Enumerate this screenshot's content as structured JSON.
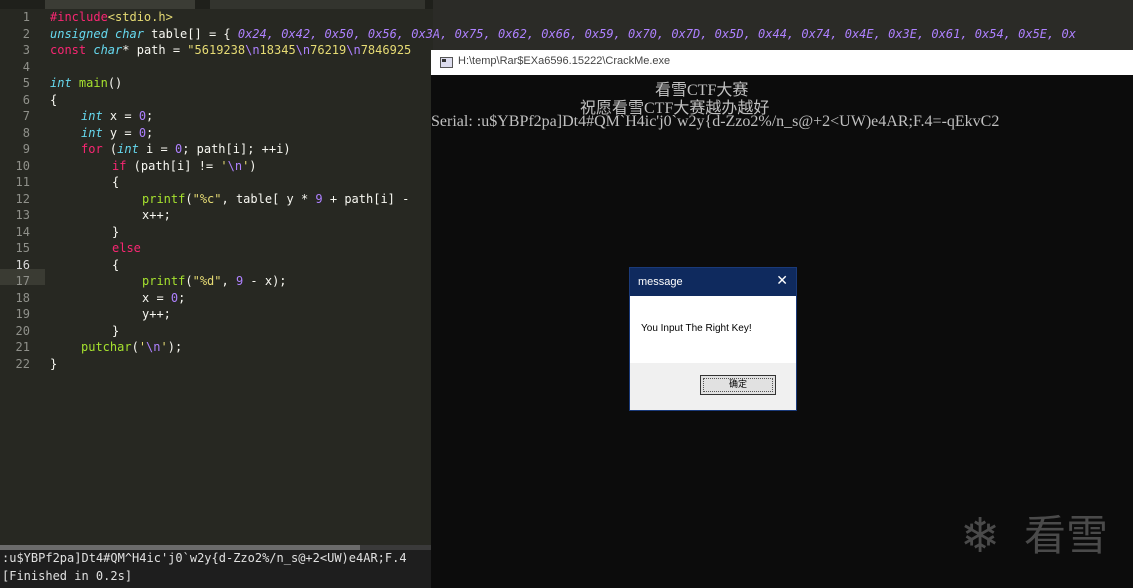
{
  "editor": {
    "line_numbers": [
      "1",
      "2",
      "3",
      "4",
      "5",
      "6",
      "7",
      "8",
      "9",
      "10",
      "11",
      "12",
      "13",
      "14",
      "15",
      "16",
      "17",
      "18",
      "19",
      "20",
      "21",
      "22"
    ],
    "code": {
      "l1_include": "#include",
      "l1_header": "<stdio.h>",
      "l2_unsigned": "unsigned",
      "l2_char": "char",
      "l2_rest": " table[] = { ",
      "l2_values": "0x24, 0x42, 0x50, 0x56, 0x3A, 0x75, 0x62, 0x66, 0x59, 0x70, 0x7D, 0x5D, 0x44, 0x74, 0x4E, 0x3E, 0x61, 0x54, 0x5E, 0x",
      "l3_const": "const",
      "l3_char": "char",
      "l3_rest": "* path = ",
      "l3_str_a": "\"5619238",
      "l3_esc1": "\\n",
      "l3_str_b": "18345",
      "l3_esc2": "\\n",
      "l3_str_c": "76219",
      "l3_esc3": "\\n",
      "l3_str_d": "7846925",
      "l5_int": "int",
      "l5_main": "main",
      "l5_rest": "()",
      "l6": "{",
      "l7_int": "int",
      "l7_rest": " x = ",
      "l7_num": "0",
      "l7_end": ";",
      "l8_int": "int",
      "l8_rest": " y = ",
      "l8_num": "0",
      "l8_end": ";",
      "l9_for": "for",
      "l9_a": " (",
      "l9_int": "int",
      "l9_b": " i = ",
      "l9_num": "0",
      "l9_c": "; path[i]; ++i)",
      "l10_if": "if",
      "l10_a": " (path[i] != ",
      "l10_q1": "'",
      "l10_esc": "\\n",
      "l10_q2": "'",
      "l10_b": ")",
      "l11": "{",
      "l12_fn": "printf",
      "l12_a": "(",
      "l12_str": "\"%c\"",
      "l12_b": ", table[ y * ",
      "l12_num": "9",
      "l12_c": " + path[i] -",
      "l13": "x++;",
      "l14": "}",
      "l15_else": "else",
      "l16": "{",
      "l17_fn": "printf",
      "l17_a": "(",
      "l17_str": "\"%d\"",
      "l17_b": ", ",
      "l17_num": "9",
      "l17_c": " - x);",
      "l18_a": "x = ",
      "l18_num": "0",
      "l18_b": ";",
      "l19": "y++;",
      "l20": "}",
      "l21_fn": "putchar",
      "l21_a": "(",
      "l21_q1": "'",
      "l21_esc": "\\n",
      "l21_q2": "'",
      "l21_b": ");",
      "l22": "}"
    },
    "output": {
      "line1": ":u$YBPf2pa]Dt4#QM^H4ic'j0`w2y{d-Zzo2%/n_s@+2<UW)e4AR;F.4",
      "line2": "[Finished in 0.2s]"
    }
  },
  "console": {
    "title": "H:\\temp\\Rar$EXa6596.15222\\CrackMe.exe",
    "line1": "看雪CTF大赛",
    "line2": "祝愿看雪CTF大赛越办越好",
    "line3": "Serial: :u$YBPf2pa]Dt4#QM`H4ic'j0`w2y{d-Zzo2%/n_s@+2<UW)e4AR;F.4=-qEkvC2"
  },
  "watermark": {
    "text": "看雪"
  },
  "dialog": {
    "title": "message",
    "message": "You Input The Right Key!",
    "ok_label": "确定"
  }
}
